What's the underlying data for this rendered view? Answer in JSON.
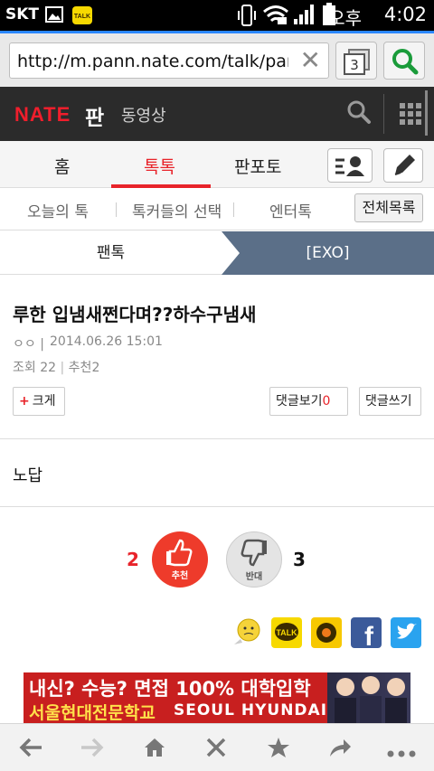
{
  "status_bar": {
    "carrier": "SKT",
    "ampm": "오후",
    "time": "4:02"
  },
  "browser": {
    "url": "http://m.pann.nate.com/talk/pan...",
    "tab_count": "3"
  },
  "header": {
    "logo": "NATE",
    "pan": "판",
    "video": "동영상"
  },
  "main_tabs": [
    {
      "label": "홈"
    },
    {
      "label": "톡톡",
      "active": true
    },
    {
      "label": "판포토"
    }
  ],
  "sub_tabs": [
    {
      "label": "오늘의 톡"
    },
    {
      "label": "톡커들의 선택"
    },
    {
      "label": "엔터톡"
    }
  ],
  "all_list_label": "전체목록",
  "breadcrumb": {
    "left": "팬톡",
    "right": "[EXO]"
  },
  "post": {
    "title": "루한 입냄새쩐다며??하수구냄새",
    "author": "ㅇㅇ",
    "date": "2014.06.26 15:01",
    "views_label": "조회",
    "views": "22",
    "recommend_label": "추천",
    "recommend": "2",
    "body": "노답"
  },
  "buttons": {
    "bigger": "크게",
    "view_comments": "댓글보기",
    "comment_count": "0",
    "write_comment": "댓글쓰기"
  },
  "votes": {
    "up_count": "2",
    "up_label": "추천",
    "down_label": "반대",
    "down_count": "3"
  },
  "ad": {
    "line1": "내신? 수능? 면접 100% 대학입학",
    "line2": "서울현대전문학교",
    "line2_en": "SEOUL HYUNDAI"
  },
  "colors": {
    "accent": "#e8232a",
    "header_bg": "#2b2b2b",
    "crumb_bg": "#5b6f88",
    "url_accent": "#2b87ff"
  }
}
